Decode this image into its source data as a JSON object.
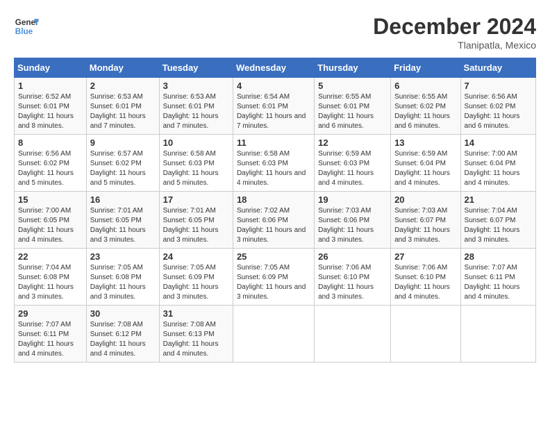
{
  "header": {
    "logo_line1": "General",
    "logo_line2": "Blue",
    "month": "December 2024",
    "location": "Tlanipatla, Mexico"
  },
  "days_of_week": [
    "Sunday",
    "Monday",
    "Tuesday",
    "Wednesday",
    "Thursday",
    "Friday",
    "Saturday"
  ],
  "weeks": [
    [
      {
        "day": "1",
        "rise": "6:52 AM",
        "set": "6:01 PM",
        "daylight": "11 hours and 8 minutes."
      },
      {
        "day": "2",
        "rise": "6:53 AM",
        "set": "6:01 PM",
        "daylight": "11 hours and 7 minutes."
      },
      {
        "day": "3",
        "rise": "6:53 AM",
        "set": "6:01 PM",
        "daylight": "11 hours and 7 minutes."
      },
      {
        "day": "4",
        "rise": "6:54 AM",
        "set": "6:01 PM",
        "daylight": "11 hours and 7 minutes."
      },
      {
        "day": "5",
        "rise": "6:55 AM",
        "set": "6:01 PM",
        "daylight": "11 hours and 6 minutes."
      },
      {
        "day": "6",
        "rise": "6:55 AM",
        "set": "6:02 PM",
        "daylight": "11 hours and 6 minutes."
      },
      {
        "day": "7",
        "rise": "6:56 AM",
        "set": "6:02 PM",
        "daylight": "11 hours and 6 minutes."
      }
    ],
    [
      {
        "day": "8",
        "rise": "6:56 AM",
        "set": "6:02 PM",
        "daylight": "11 hours and 5 minutes."
      },
      {
        "day": "9",
        "rise": "6:57 AM",
        "set": "6:02 PM",
        "daylight": "11 hours and 5 minutes."
      },
      {
        "day": "10",
        "rise": "6:58 AM",
        "set": "6:03 PM",
        "daylight": "11 hours and 5 minutes."
      },
      {
        "day": "11",
        "rise": "6:58 AM",
        "set": "6:03 PM",
        "daylight": "11 hours and 4 minutes."
      },
      {
        "day": "12",
        "rise": "6:59 AM",
        "set": "6:03 PM",
        "daylight": "11 hours and 4 minutes."
      },
      {
        "day": "13",
        "rise": "6:59 AM",
        "set": "6:04 PM",
        "daylight": "11 hours and 4 minutes."
      },
      {
        "day": "14",
        "rise": "7:00 AM",
        "set": "6:04 PM",
        "daylight": "11 hours and 4 minutes."
      }
    ],
    [
      {
        "day": "15",
        "rise": "7:00 AM",
        "set": "6:05 PM",
        "daylight": "11 hours and 4 minutes."
      },
      {
        "day": "16",
        "rise": "7:01 AM",
        "set": "6:05 PM",
        "daylight": "11 hours and 3 minutes."
      },
      {
        "day": "17",
        "rise": "7:01 AM",
        "set": "6:05 PM",
        "daylight": "11 hours and 3 minutes."
      },
      {
        "day": "18",
        "rise": "7:02 AM",
        "set": "6:06 PM",
        "daylight": "11 hours and 3 minutes."
      },
      {
        "day": "19",
        "rise": "7:03 AM",
        "set": "6:06 PM",
        "daylight": "11 hours and 3 minutes."
      },
      {
        "day": "20",
        "rise": "7:03 AM",
        "set": "6:07 PM",
        "daylight": "11 hours and 3 minutes."
      },
      {
        "day": "21",
        "rise": "7:04 AM",
        "set": "6:07 PM",
        "daylight": "11 hours and 3 minutes."
      }
    ],
    [
      {
        "day": "22",
        "rise": "7:04 AM",
        "set": "6:08 PM",
        "daylight": "11 hours and 3 minutes."
      },
      {
        "day": "23",
        "rise": "7:05 AM",
        "set": "6:08 PM",
        "daylight": "11 hours and 3 minutes."
      },
      {
        "day": "24",
        "rise": "7:05 AM",
        "set": "6:09 PM",
        "daylight": "11 hours and 3 minutes."
      },
      {
        "day": "25",
        "rise": "7:05 AM",
        "set": "6:09 PM",
        "daylight": "11 hours and 3 minutes."
      },
      {
        "day": "26",
        "rise": "7:06 AM",
        "set": "6:10 PM",
        "daylight": "11 hours and 3 minutes."
      },
      {
        "day": "27",
        "rise": "7:06 AM",
        "set": "6:10 PM",
        "daylight": "11 hours and 4 minutes."
      },
      {
        "day": "28",
        "rise": "7:07 AM",
        "set": "6:11 PM",
        "daylight": "11 hours and 4 minutes."
      }
    ],
    [
      {
        "day": "29",
        "rise": "7:07 AM",
        "set": "6:11 PM",
        "daylight": "11 hours and 4 minutes."
      },
      {
        "day": "30",
        "rise": "7:08 AM",
        "set": "6:12 PM",
        "daylight": "11 hours and 4 minutes."
      },
      {
        "day": "31",
        "rise": "7:08 AM",
        "set": "6:13 PM",
        "daylight": "11 hours and 4 minutes."
      },
      null,
      null,
      null,
      null
    ]
  ]
}
